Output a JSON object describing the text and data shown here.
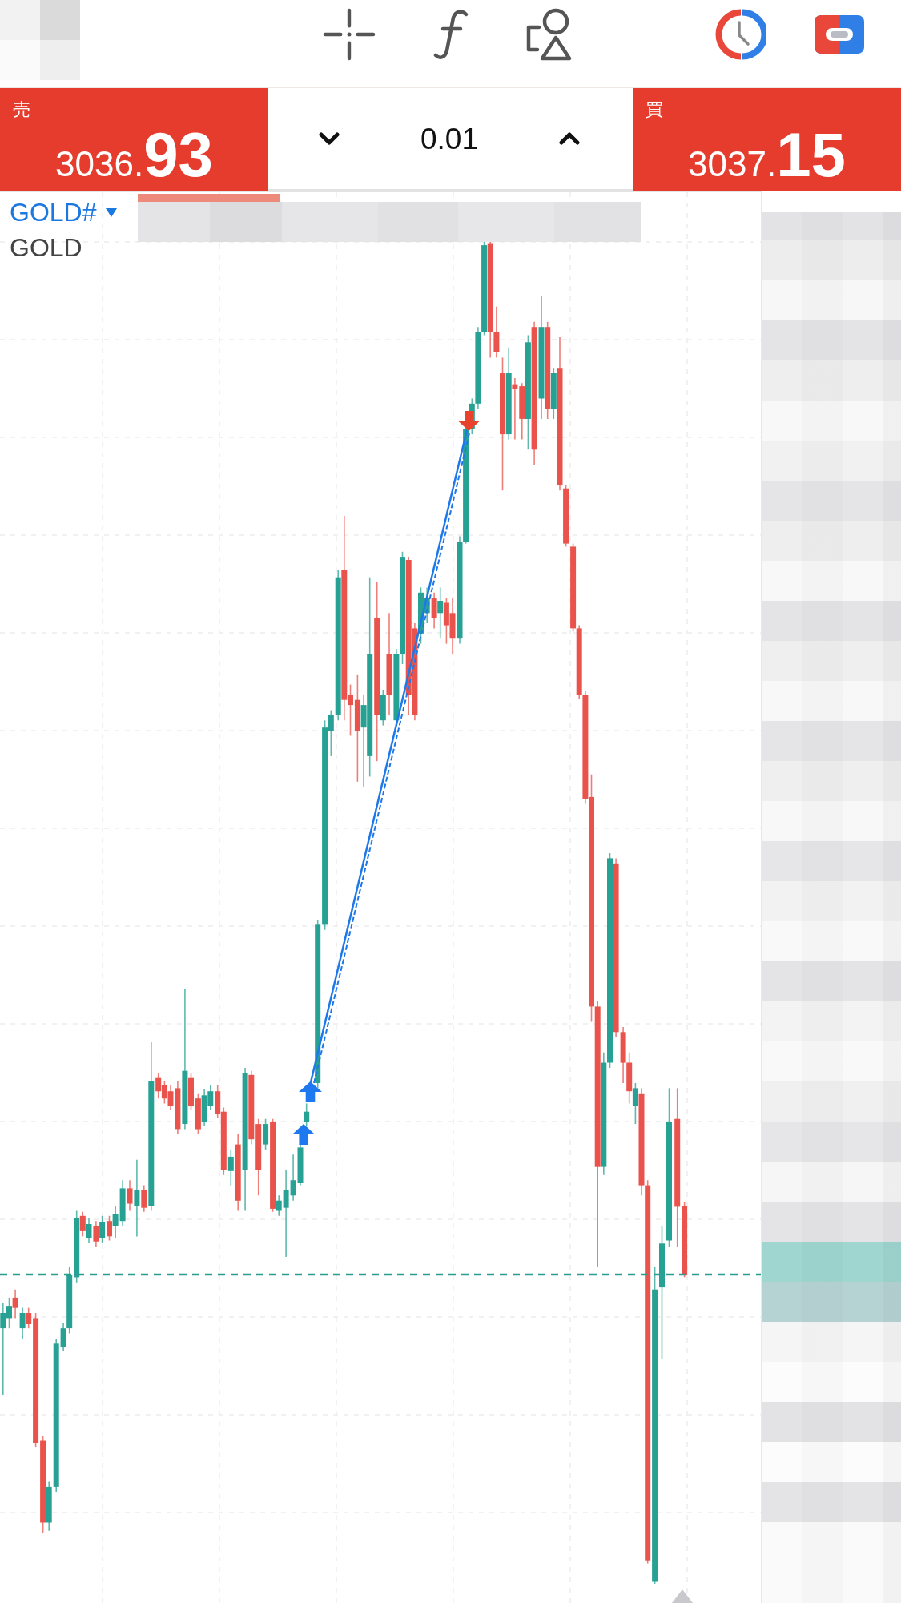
{
  "trade_panel": {
    "sell": {
      "label": "売",
      "price_base": "3036.",
      "price_pips": "93"
    },
    "lot_size": "0.01",
    "buy": {
      "label": "買",
      "price_base": "3037.",
      "price_pips": "15"
    }
  },
  "chart": {
    "symbol": "GOLD#",
    "description": "GOLD"
  }
}
